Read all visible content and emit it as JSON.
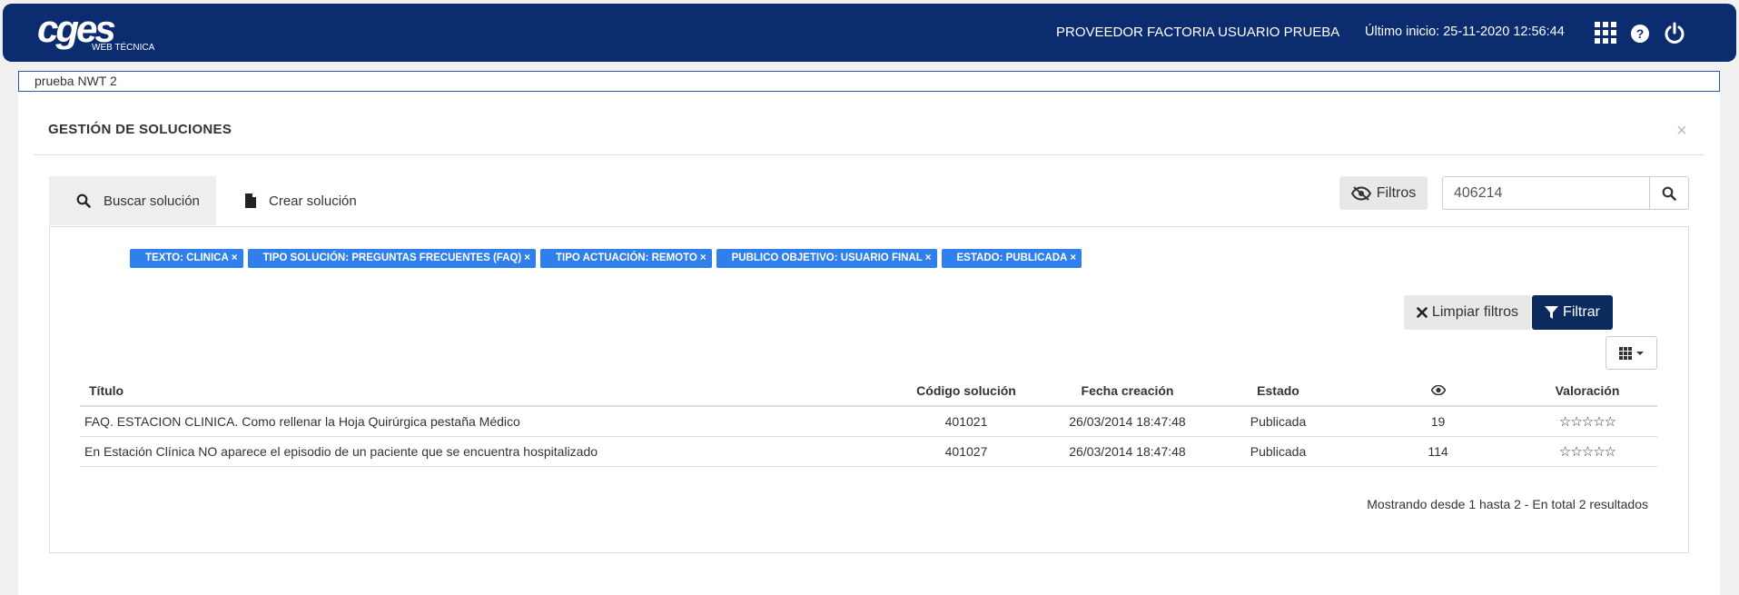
{
  "header": {
    "logo_main": "cges",
    "logo_sub": "WEB TÉCNICA",
    "user_name": "PROVEEDOR FACTORIA USUARIO PRUEBA",
    "last_login": "Último inicio: 25-11-2020 12:56:44",
    "icons": [
      "apps-grid-icon",
      "help-icon",
      "power-icon"
    ],
    "bg_color": "#0b2d6f"
  },
  "breadcrumb": {
    "text": "prueba NWT 2"
  },
  "panel": {
    "title": "GESTIÓN DE SOLUCIONES",
    "close_label": "×"
  },
  "tabs": [
    {
      "label": "Buscar solución",
      "icon": "search-icon",
      "active": true
    },
    {
      "label": "Crear solución",
      "icon": "file-icon",
      "active": false
    }
  ],
  "toolbar": {
    "filters_label": "Filtros",
    "search_value": "406214"
  },
  "active_filters": [
    {
      "label": "TEXTO: CLINICA"
    },
    {
      "label": "TIPO SOLUCIÓN: PREGUNTAS FRECUENTES (FAQ)"
    },
    {
      "label": "TIPO ACTUACIÓN: REMOTO"
    },
    {
      "label": "PUBLICO OBJETIVO: USUARIO FINAL"
    },
    {
      "label": "ESTADO: PUBLICADA"
    }
  ],
  "chip_close": "×",
  "actions": {
    "clear_label": "Limpiar filtros",
    "filter_label": "Filtrar"
  },
  "table": {
    "headers": {
      "title": "Título",
      "code": "Código solución",
      "date": "Fecha creación",
      "state": "Estado",
      "views_icon": "eye-icon",
      "rating": "Valoración"
    },
    "rows": [
      {
        "title": "FAQ. ESTACION CLINICA. Como rellenar la Hoja Quirúrgica pestaña Médico",
        "code": "401021",
        "date": "26/03/2014 18:47:48",
        "state": "Publicada",
        "views": "19",
        "rating": "☆☆☆☆☆"
      },
      {
        "title": "En Estación Clínica NO aparece el episodio de un paciente que se encuentra hospitalizado",
        "code": "401027",
        "date": "26/03/2014 18:47:48",
        "state": "Publicada",
        "views": "114",
        "rating": "☆☆☆☆☆"
      }
    ]
  },
  "pagination": {
    "info": "Mostrando desde 1 hasta 2 - En total 2 resultados"
  },
  "colors": {
    "chip": "#2f80ed",
    "primary_button": "#0b2a5e"
  }
}
